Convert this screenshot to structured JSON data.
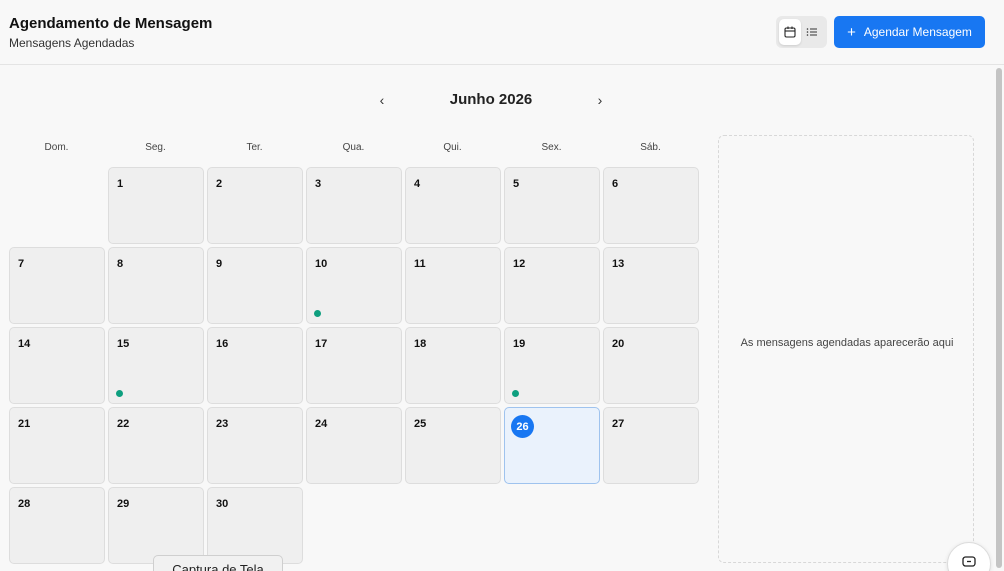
{
  "header": {
    "title": "Agendamento de Mensagem",
    "subtitle": "Mensagens Agendadas",
    "schedule_button": "Agendar Mensagem"
  },
  "view_toggle": {
    "active": "calendar",
    "options": [
      "calendar-icon",
      "list-icon"
    ]
  },
  "calendar": {
    "month_label": "Junho 2026",
    "prev_arrow": "‹",
    "next_arrow": "›",
    "weekdays": [
      "Dom.",
      "Seg.",
      "Ter.",
      "Qua.",
      "Qui.",
      "Sex.",
      "Sáb."
    ],
    "days": [
      "1",
      "2",
      "3",
      "4",
      "5",
      "6",
      "7",
      "8",
      "9",
      "10",
      "11",
      "12",
      "13",
      "14",
      "15",
      "16",
      "17",
      "18",
      "19",
      "20",
      "21",
      "22",
      "23",
      "24",
      "25",
      "26",
      "27",
      "28",
      "29",
      "30"
    ],
    "days_with_messages": [
      "10",
      "15",
      "19"
    ],
    "today": "26"
  },
  "side_panel": {
    "empty_text": "As mensagens agendadas aparecerão aqui"
  },
  "footer": {
    "screenshot_tab": "Captura de Tela"
  },
  "colors": {
    "accent": "#1877f2",
    "dot": "#0e9f7f",
    "today_bg": "#eaf2fc"
  }
}
